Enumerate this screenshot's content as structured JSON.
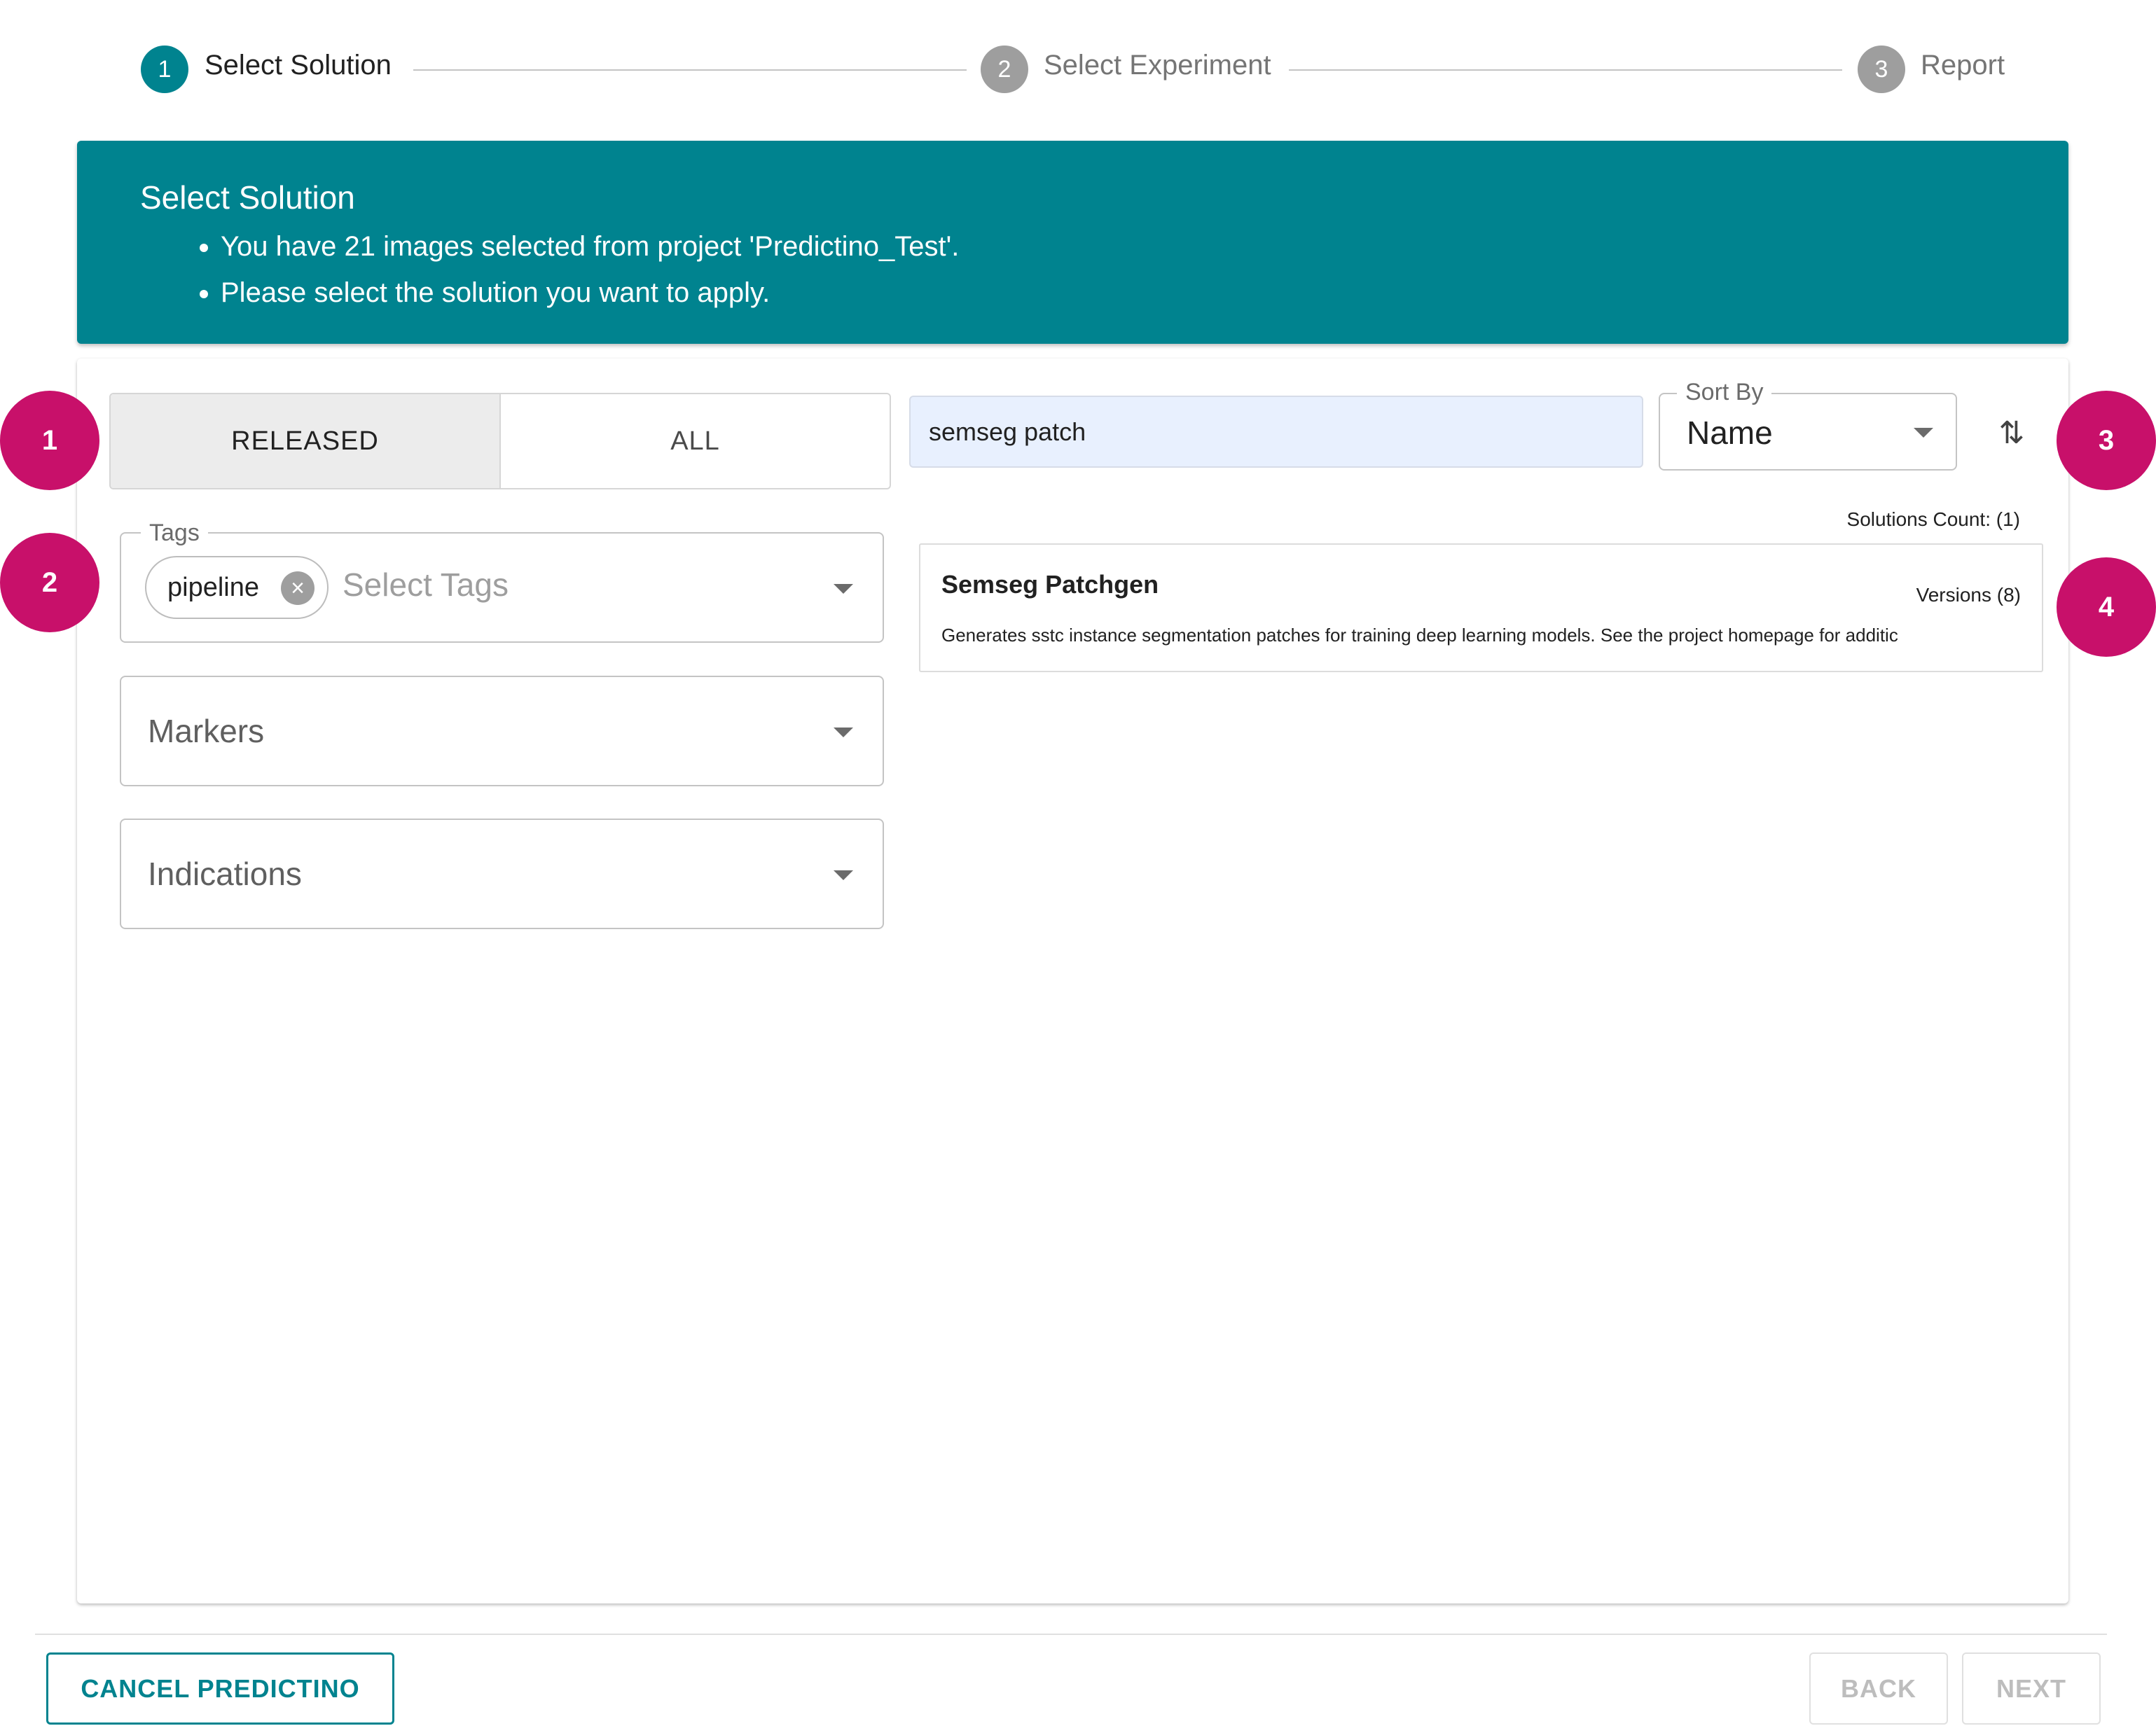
{
  "stepper": {
    "steps": [
      {
        "number": "1",
        "label": "Select Solution",
        "state": "active"
      },
      {
        "number": "2",
        "label": "Select Experiment",
        "state": "inactive"
      },
      {
        "number": "3",
        "label": "Report",
        "state": "inactive"
      }
    ]
  },
  "banner": {
    "title": "Select Solution",
    "bullets": [
      "You have 21 images selected from project 'Predictino_Test'.",
      "Please select the solution you want to apply."
    ]
  },
  "filters": {
    "toggle": {
      "released_label": "RELEASED",
      "all_label": "ALL",
      "selected": "RELEASED"
    },
    "tags": {
      "legend": "Tags",
      "chip_label": "pipeline",
      "placeholder": "Select Tags"
    },
    "markers": {
      "placeholder": "Markers"
    },
    "indications": {
      "placeholder": "Indications"
    }
  },
  "search": {
    "value": "semseg patch"
  },
  "sort": {
    "legend": "Sort By",
    "value": "Name"
  },
  "results": {
    "count_label": "Solutions Count: (1)",
    "items": [
      {
        "name": "Semseg Patchgen",
        "versions": "Versions (8)",
        "description": "Generates sstc instance segmentation patches for training deep learning models. See the project homepage for additic"
      }
    ]
  },
  "markers": [
    "1",
    "2",
    "3",
    "4"
  ],
  "footer": {
    "cancel_label": "CANCEL PREDICTINO",
    "back_label": "BACK",
    "next_label": "NEXT"
  },
  "colors": {
    "accent": "#00838f",
    "marker": "#c8106a",
    "inactive_step": "#9e9e9e",
    "search_bg": "#e8f0fe"
  },
  "icons": {
    "sort_direction": "sort-arrows-icon",
    "chip_remove": "close-circle-icon",
    "dropdown": "caret-down-icon"
  }
}
